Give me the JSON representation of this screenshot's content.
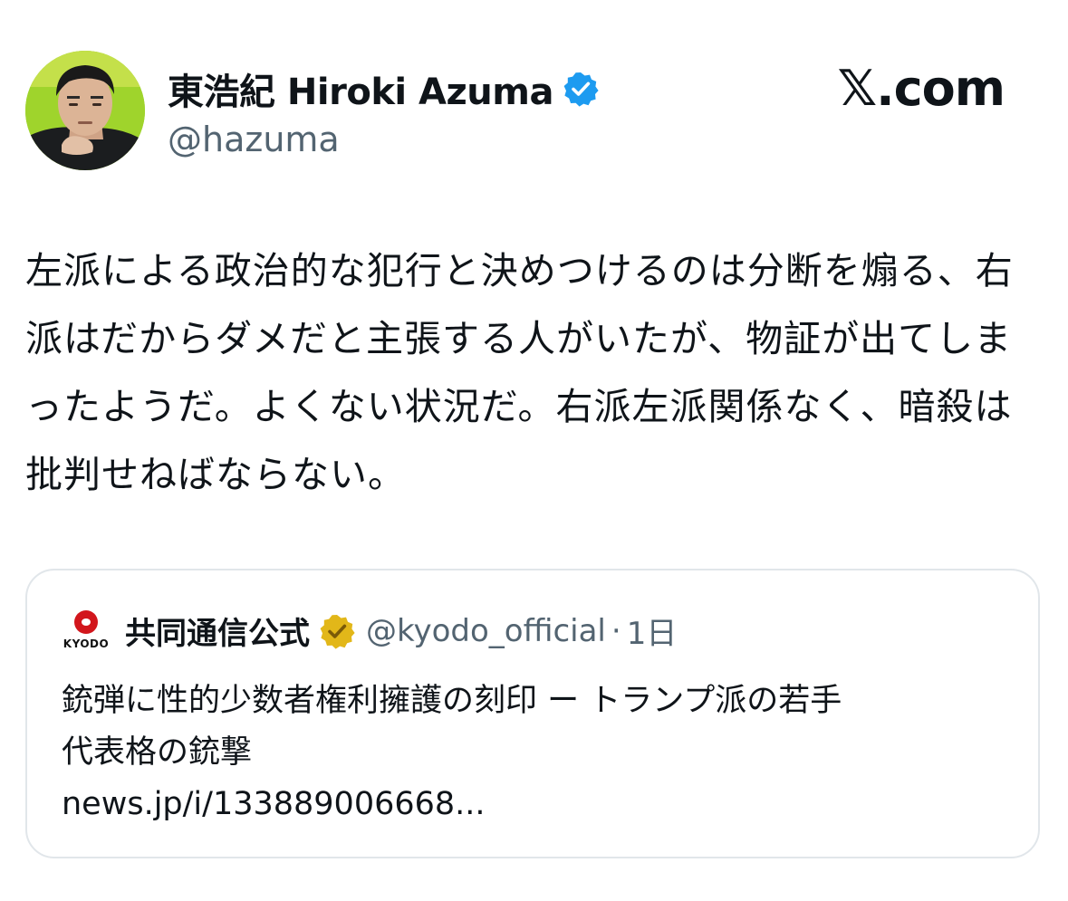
{
  "author": {
    "display_name": "東浩紀 Hiroki Azuma",
    "handle": "@hazuma",
    "verified_badge_icon": "verified-blue-badge-icon"
  },
  "brand": {
    "label": "𝕏.com"
  },
  "tweet": {
    "text": "左派による政治的な犯行と決めつけるのは分断を煽る、右派はだからダメだと主張する人がいたが、物証が出てしまったようだ。よくない状況だ。右派左派関係なく、暗殺は批判せねばならない。"
  },
  "quoted_tweet": {
    "logo_text": "KYODO",
    "display_name": "共同通信公式",
    "badge_icon": "verified-gold-badge-icon",
    "handle": "@kyodo_official",
    "separator": "·",
    "time": "1日",
    "body_line1": "銃弾に性的少数者権利擁護の刻印 ー トランプ派の若手",
    "body_line2": "代表格の銃撃",
    "link": "news.jp/i/133889006668..."
  },
  "colors": {
    "text_primary": "#0f1419",
    "text_secondary": "#536471",
    "verified_blue": "#1d9bf0",
    "verified_gold": "#e2b719",
    "kyodo_red": "#d2161c",
    "card_border": "#e1e6ea"
  }
}
